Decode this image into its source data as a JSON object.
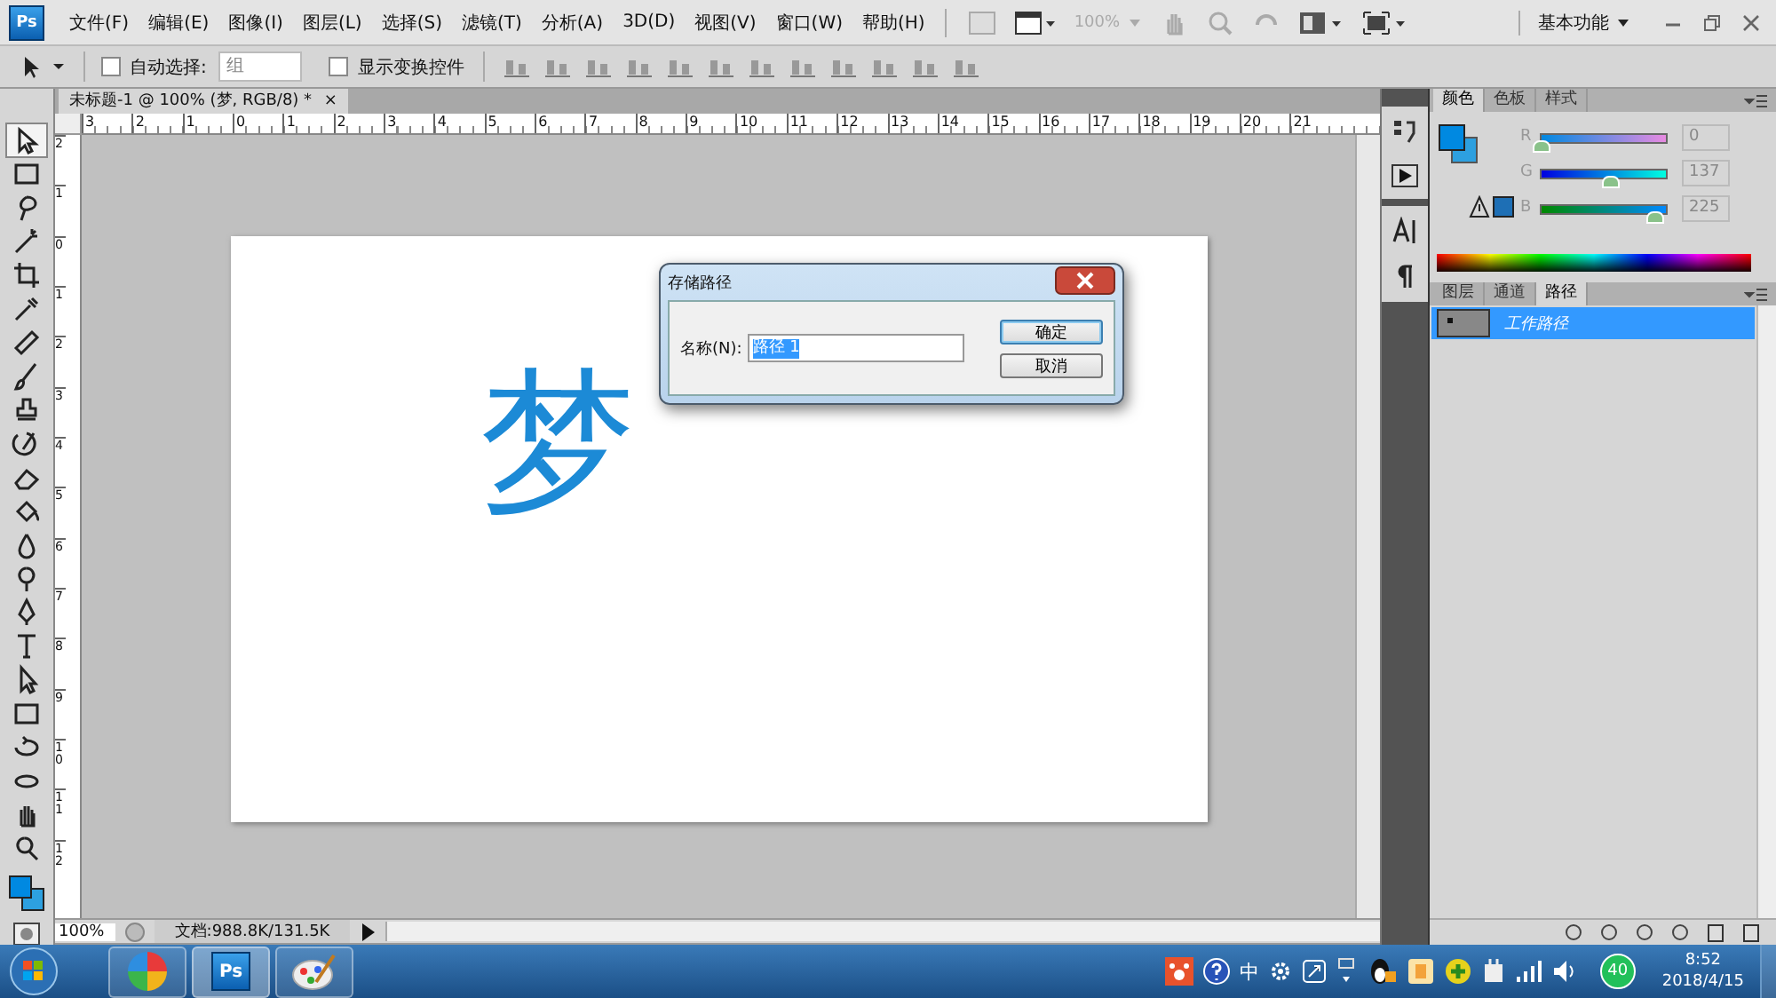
{
  "app": {
    "logo": "Ps",
    "menus": [
      "文件(F)",
      "编辑(E)",
      "图像(I)",
      "图层(L)",
      "选择(S)",
      "滤镜(T)",
      "分析(A)",
      "3D(D)",
      "视图(V)",
      "窗口(W)",
      "帮助(H)"
    ],
    "zoom": "100%",
    "workspace": "基本功能"
  },
  "options_bar": {
    "auto_select": {
      "label": "自动选择:",
      "checked": false
    },
    "auto_select_target": "组",
    "show_transform": {
      "label": "显示变换控件",
      "checked": false
    }
  },
  "document": {
    "tab_title": "未标题-1 @ 100% (梦, RGB/8) *",
    "close": "×",
    "ruler_h": [
      "3",
      "2",
      "1",
      "0",
      "1",
      "2",
      "3",
      "4",
      "5",
      "6",
      "7",
      "8",
      "9",
      "10",
      "11",
      "12",
      "13",
      "14",
      "15",
      "16",
      "17",
      "18",
      "19",
      "20",
      "21"
    ],
    "ruler_v": [
      "2",
      "1",
      "0",
      "1",
      "2",
      "3",
      "4",
      "5",
      "6",
      "7",
      "8",
      "9",
      "10",
      "11",
      "12"
    ],
    "canvas_text": "梦",
    "status": {
      "zoom": "100%",
      "info": "文档:988.8K/131.5K"
    }
  },
  "dialog": {
    "title": "存储路径",
    "name_label": "名称(N):",
    "name_value": "路径 1",
    "buttons": [
      {
        "label": "确定",
        "default": true
      },
      {
        "label": "取消",
        "default": false
      }
    ]
  },
  "color_panel": {
    "tabs": [
      {
        "label": "颜色",
        "selected": true
      },
      {
        "label": "色板",
        "selected": false
      },
      {
        "label": "样式",
        "selected": false
      }
    ],
    "channels": [
      {
        "label": "R",
        "level": 0,
        "value": "0"
      },
      {
        "label": "G",
        "level": 0.537,
        "value": "137"
      },
      {
        "label": "B",
        "level": 0.882,
        "value": "225"
      }
    ]
  },
  "paths_panel": {
    "tabs": [
      {
        "label": "图层",
        "selected": false
      },
      {
        "label": "通道",
        "selected": false
      },
      {
        "label": "路径",
        "selected": true
      }
    ],
    "paths": [
      {
        "name": "工作路径",
        "selected": true
      }
    ]
  },
  "taskbar": {
    "apps": [
      {
        "kind": "pinwheel",
        "active": false
      },
      {
        "kind": "photoshop",
        "label": "Ps",
        "active": true
      },
      {
        "kind": "paint",
        "active": false
      }
    ],
    "ime": "中",
    "badge": "40",
    "time": "8:52",
    "date": "2018/4/15"
  }
}
